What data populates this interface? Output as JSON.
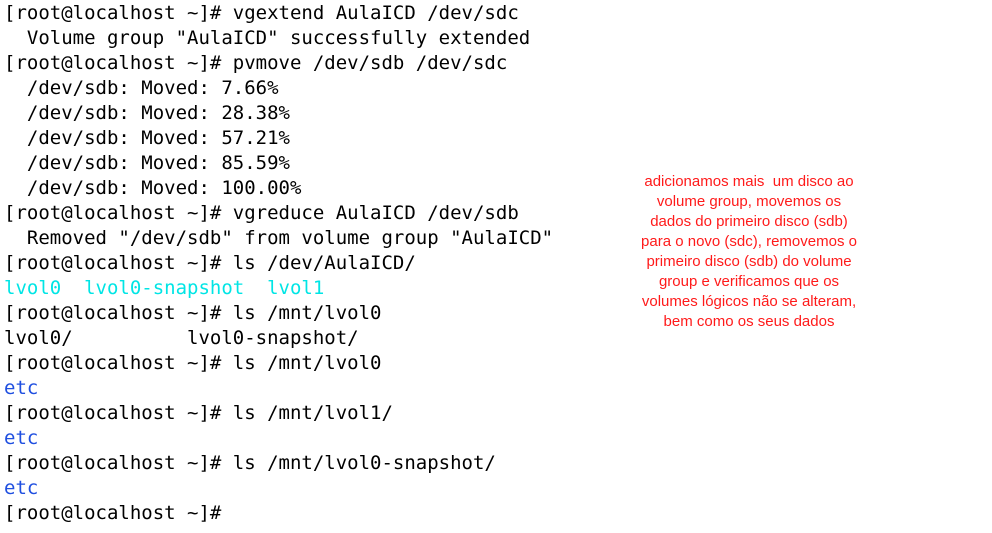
{
  "terminal": {
    "lines": [
      {
        "text": "[root@localhost ~]# vgextend AulaICD /dev/sdc",
        "style": "normal"
      },
      {
        "text": "  Volume group \"AulaICD\" successfully extended",
        "style": "normal"
      },
      {
        "text": "[root@localhost ~]# pvmove /dev/sdb /dev/sdc",
        "style": "normal"
      },
      {
        "text": "  /dev/sdb: Moved: 7.66%",
        "style": "normal"
      },
      {
        "text": "  /dev/sdb: Moved: 28.38%",
        "style": "normal"
      },
      {
        "text": "  /dev/sdb: Moved: 57.21%",
        "style": "normal"
      },
      {
        "text": "  /dev/sdb: Moved: 85.59%",
        "style": "normal"
      },
      {
        "text": "  /dev/sdb: Moved: 100.00%",
        "style": "normal"
      },
      {
        "text": "[root@localhost ~]# vgreduce AulaICD /dev/sdb",
        "style": "normal"
      },
      {
        "text": "  Removed \"/dev/sdb\" from volume group \"AulaICD\"",
        "style": "normal"
      },
      {
        "text": "[root@localhost ~]# ls /dev/AulaICD/",
        "style": "normal"
      },
      {
        "text": "lvol0  lvol0-snapshot  lvol1",
        "style": "cyan"
      },
      {
        "text": "[root@localhost ~]# ls /mnt/lvol0",
        "style": "normal"
      },
      {
        "text": "lvol0/          lvol0-snapshot/",
        "style": "normal"
      },
      {
        "text": "[root@localhost ~]# ls /mnt/lvol0",
        "style": "normal"
      },
      {
        "text": "etc",
        "style": "blue"
      },
      {
        "text": "[root@localhost ~]# ls /mnt/lvol1/",
        "style": "normal"
      },
      {
        "text": "etc",
        "style": "blue"
      },
      {
        "text": "[root@localhost ~]# ls /mnt/lvol0-snapshot/",
        "style": "normal"
      },
      {
        "text": "etc",
        "style": "blue"
      },
      {
        "text": "[root@localhost ~]#",
        "style": "normal"
      }
    ]
  },
  "annotation": {
    "lines": [
      "adicionamos mais  um disco ao",
      "volume group, movemos os",
      "dados do primeiro disco (sdb)",
      "para o novo (sdc), removemos o",
      "primeiro disco (sdb) do volume",
      "group e verificamos que os",
      "volumes lógicos não se alteram,",
      "bem como os seus dados"
    ]
  },
  "colors": {
    "background": "#ffffff",
    "text": "#000000",
    "directory_cyan": "#00e5e5",
    "directory_blue": "#1f4fe0",
    "annotation_red": "#ff1a1a"
  }
}
